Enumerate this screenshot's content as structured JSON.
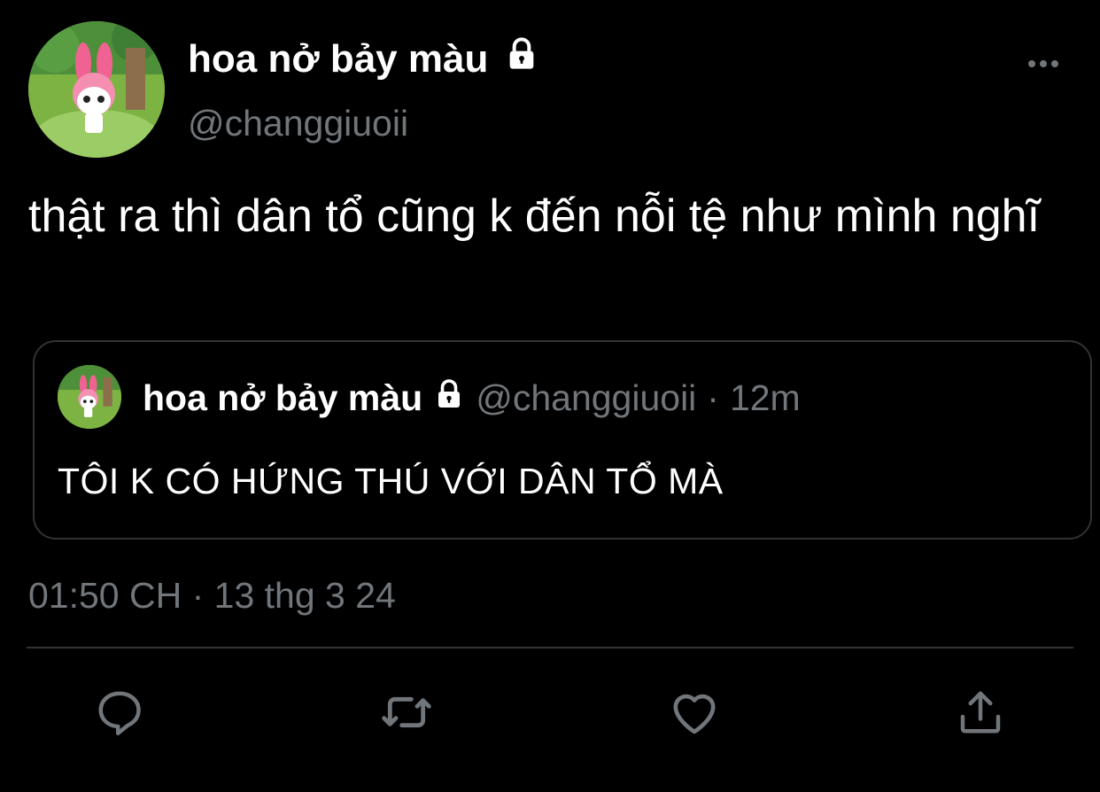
{
  "author": {
    "display_name": "hoa nở bảy màu",
    "handle": "@changgiuoii",
    "protected_icon": "lock-icon"
  },
  "tweet": {
    "text": "thật ra thì dân tổ cũng k đến nỗi tệ như mình nghĩ",
    "timestamp": "01:50 CH · 13 thg 3 24"
  },
  "quote": {
    "display_name": "hoa nở bảy màu",
    "handle": "@changgiuoii",
    "separator": "·",
    "time_ago": "12m",
    "text": "TÔI K CÓ HỨNG THÚ VỚI DÂN TỔ MÀ"
  },
  "actions": [
    "reply-icon",
    "retweet-icon",
    "like-icon",
    "share-icon"
  ],
  "colors": {
    "background": "#000000",
    "text": "#ffffff",
    "secondary": "#71767b",
    "border": "#2f3336"
  }
}
